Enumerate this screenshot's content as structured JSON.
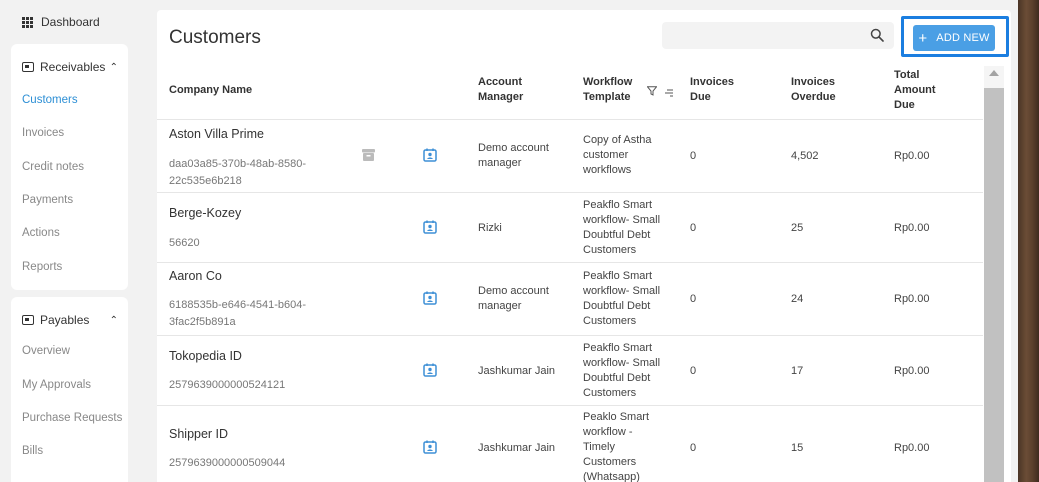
{
  "sidebar": {
    "dashboard": "Dashboard",
    "receivables": {
      "title": "Receivables",
      "items": [
        "Customers",
        "Invoices",
        "Credit notes",
        "Payments",
        "Actions",
        "Reports"
      ]
    },
    "payables": {
      "title": "Payables",
      "items": [
        "Overview",
        "My Approvals",
        "Purchase Requests",
        "Bills"
      ]
    }
  },
  "page": {
    "title": "Customers",
    "search_placeholder": "",
    "add_new_label": "ADD NEW"
  },
  "table": {
    "headers": {
      "company": "Company Name",
      "manager_1": "Account",
      "manager_2": "Manager",
      "workflow_1": "Workflow",
      "workflow_2": "Template",
      "due_1": "Invoices",
      "due_2": "Due",
      "overdue_1": "Invoices",
      "overdue_2": "Overdue",
      "total_1": "Total",
      "total_2": "Amount",
      "total_3": "Due"
    },
    "rows": [
      {
        "name": "Aston Villa Prime",
        "id_1": "daa03a85-370b-48ab-8580-",
        "id_2": "22c535e6b218",
        "manager_1": "Demo account",
        "manager_2": "manager",
        "workflow": [
          "Copy of Astha",
          "customer",
          "workflows"
        ],
        "due": "0",
        "overdue": "4,502",
        "total": "Rp0.00"
      },
      {
        "name": "Berge-Kozey",
        "id_1": "56620",
        "id_2": "",
        "manager_1": "Rizki",
        "manager_2": "",
        "workflow": [
          "Peakflo Smart",
          "workflow- Small",
          "Doubtful Debt",
          "Customers"
        ],
        "due": "0",
        "overdue": "25",
        "total": "Rp0.00"
      },
      {
        "name": "Aaron Co",
        "id_1": "6188535b-e646-4541-b604-",
        "id_2": "3fac2f5b891a",
        "manager_1": "Demo account",
        "manager_2": "manager",
        "workflow": [
          "Peakflo Smart",
          "workflow- Small",
          "Doubtful Debt",
          "Customers"
        ],
        "due": "0",
        "overdue": "24",
        "total": "Rp0.00"
      },
      {
        "name": "Tokopedia ID",
        "id_1": "2579639000000524121",
        "id_2": "",
        "manager_1": "Jashkumar Jain",
        "manager_2": "",
        "workflow": [
          "Peakflo Smart",
          "workflow- Small",
          "Doubtful Debt",
          "Customers"
        ],
        "due": "0",
        "overdue": "17",
        "total": "Rp0.00"
      },
      {
        "name": "Shipper ID",
        "id_1": "2579639000000509044",
        "id_2": "",
        "manager_1": "Jashkumar Jain",
        "manager_2": "",
        "workflow": [
          "Peaklo Smart",
          "workflow -",
          "Timely",
          "Customers",
          "(Whatsapp)"
        ],
        "due": "0",
        "overdue": "15",
        "total": "Rp0.00"
      }
    ]
  },
  "colors": {
    "accent": "#2d8fd5",
    "button": "#4a9fe5",
    "highlight_border": "#1b7ee0"
  }
}
